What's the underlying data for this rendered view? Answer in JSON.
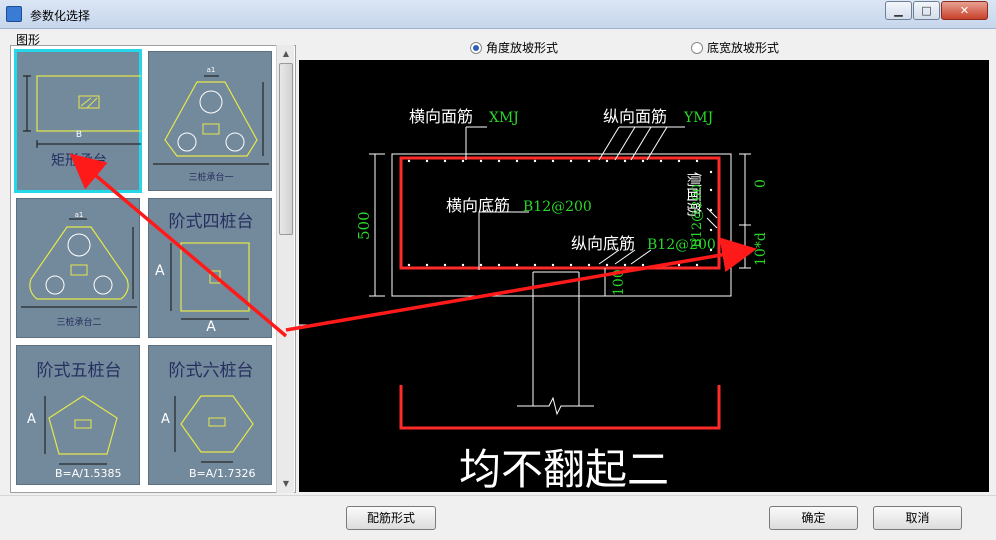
{
  "window": {
    "title": "参数化选择",
    "min_label": "▁",
    "max_label": "□",
    "close_label": "✕"
  },
  "group": {
    "label": "图形"
  },
  "thumbnails": [
    {
      "caption": "矩形承台",
      "dim": "B"
    },
    {
      "caption": "三桩承台一",
      "dim": "a1"
    },
    {
      "caption": "三桩承台二",
      "dim": "a1"
    },
    {
      "caption": "阶式四桩台",
      "dim_a": "A",
      "dim_b": "A"
    },
    {
      "caption": "阶式五桩台",
      "dim_a": "A",
      "formula": "B=A/1.5385"
    },
    {
      "caption": "阶式六桩台",
      "dim_a": "A",
      "formula": "B=A/1.7326"
    }
  ],
  "options": {
    "angle": {
      "label": "角度放坡形式",
      "selected": true
    },
    "width": {
      "label": "底宽放坡形式",
      "selected": false
    }
  },
  "drawing": {
    "top_h_label": "横向面筋",
    "top_h_code": "XMJ",
    "top_v_label": "纵向面筋",
    "top_v_code": "YMJ",
    "bot_h_label": "横向底筋",
    "bot_h_code": "B12@200",
    "bot_v_label": "纵向底筋",
    "bot_v_code": "B12@200",
    "side_label": "侧面筋",
    "side_code": "B12@200",
    "height": "500",
    "cover": "0",
    "anchor": "10*d",
    "bottom_cover": "100",
    "caption": "均不翻起二",
    "colors": {
      "steel": "#ff2a2a",
      "code": "#2ad62a",
      "line": "#ffffff",
      "arrow": "#ff1a1a"
    }
  },
  "buttons": {
    "rebar_form": "配筋形式",
    "ok": "确定",
    "cancel": "取消"
  }
}
